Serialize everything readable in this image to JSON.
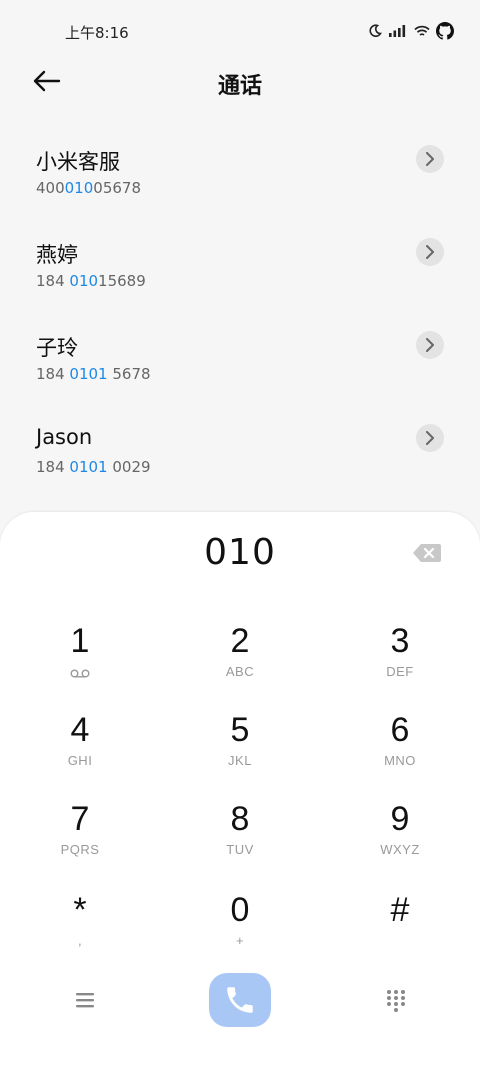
{
  "status_bar": {
    "time": "上午8:16",
    "icons": [
      "moon-icon",
      "signal-icon",
      "wifi-icon",
      "github-icon"
    ]
  },
  "header": {
    "title": "通话",
    "back_icon": "arrow-left-icon"
  },
  "contacts": [
    {
      "name": "小米客服",
      "number_pre": "400",
      "number_match": "010",
      "number_post": "05678"
    },
    {
      "name": "燕婷",
      "number_pre": "184 ",
      "number_match": "010",
      "number_post": "15689"
    },
    {
      "name": "子玲",
      "number_pre": "184 ",
      "number_match": "0101",
      "number_post": " 5678"
    },
    {
      "name": "Jason",
      "number_pre": "184 ",
      "number_match": "0101",
      "number_post": " 0029"
    }
  ],
  "dialer": {
    "display": "010",
    "keys": [
      {
        "digit": "1",
        "letters": ""
      },
      {
        "digit": "2",
        "letters": "ABC"
      },
      {
        "digit": "3",
        "letters": "DEF"
      },
      {
        "digit": "4",
        "letters": "GHI"
      },
      {
        "digit": "5",
        "letters": "JKL"
      },
      {
        "digit": "6",
        "letters": "MNO"
      },
      {
        "digit": "7",
        "letters": "PQRS"
      },
      {
        "digit": "8",
        "letters": "TUV"
      },
      {
        "digit": "9",
        "letters": "WXYZ"
      },
      {
        "digit": "*",
        "letters": ","
      },
      {
        "digit": "0",
        "letters": "+"
      },
      {
        "digit": "#",
        "letters": ""
      }
    ]
  },
  "colors": {
    "accent": "#1e88e5",
    "call_button": "#a8c7f4",
    "background": "#f6f6f6"
  }
}
